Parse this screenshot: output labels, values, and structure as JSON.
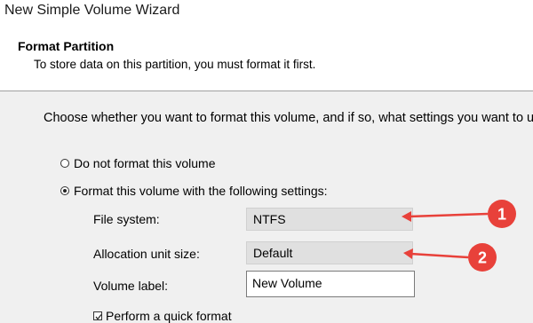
{
  "window": {
    "title": "New Simple Volume Wizard"
  },
  "header": {
    "title": "Format Partition",
    "subtitle": "To store data on this partition, you must format it first."
  },
  "instruction": "Choose whether you want to format this volume, and if so, what settings you want to use.",
  "options": {
    "do_not_format": {
      "label": "Do not format this volume",
      "selected": false
    },
    "format": {
      "label": "Format this volume with the following settings:",
      "selected": true
    }
  },
  "settings": {
    "file_system": {
      "label": "File system:",
      "value": "NTFS"
    },
    "allocation_unit_size": {
      "label": "Allocation unit size:",
      "value": "Default"
    },
    "volume_label": {
      "label": "Volume label:",
      "value": "New Volume"
    }
  },
  "quick_format": {
    "label": "Perform a quick format",
    "checked": true
  },
  "annotations": {
    "badge_1": "1",
    "badge_2": "2",
    "color": "#e8413a"
  }
}
